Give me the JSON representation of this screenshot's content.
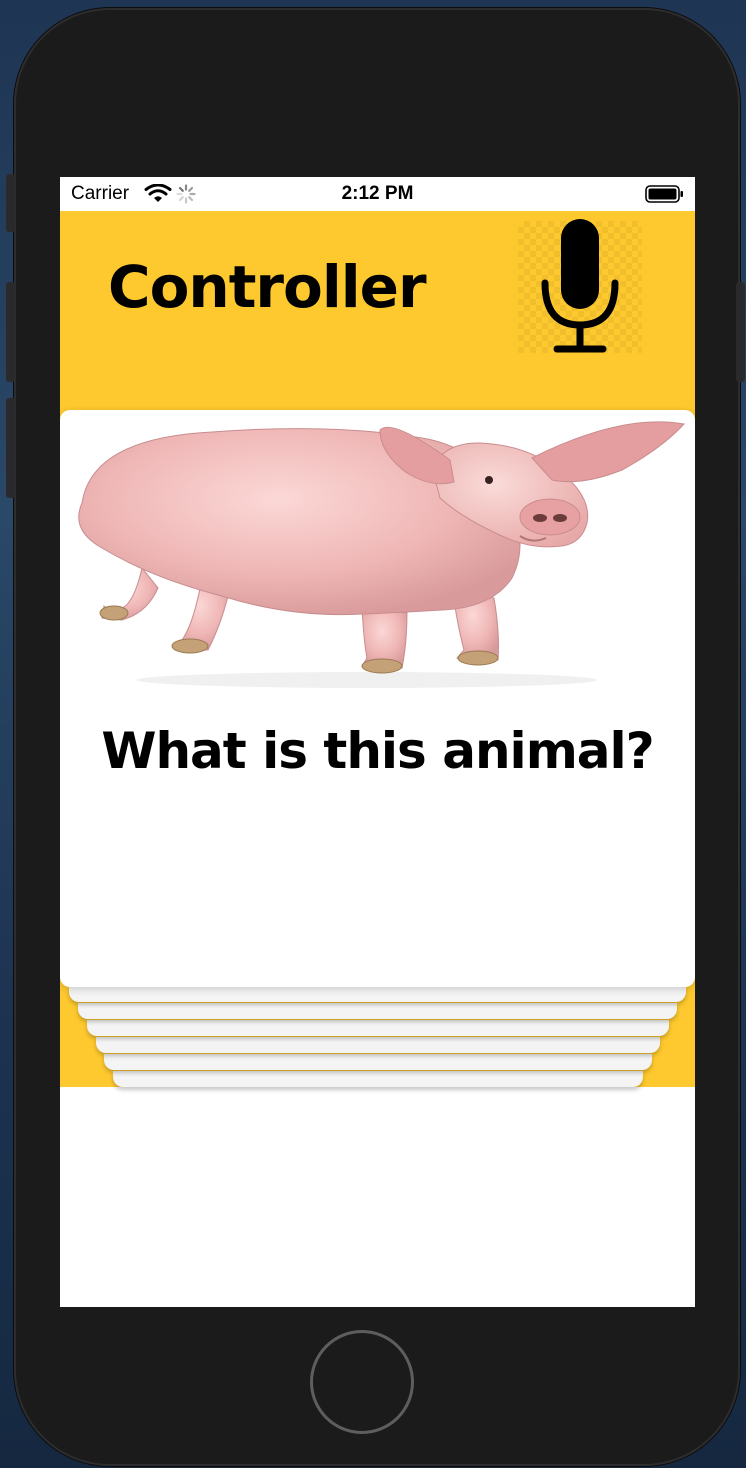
{
  "status_bar": {
    "carrier": "Carrier",
    "time": "2:12 PM"
  },
  "header": {
    "title": "Controller",
    "mic_icon": "microphone-icon",
    "background_color": "#fec92e"
  },
  "card": {
    "image": "pig",
    "question": "What is this animal?"
  },
  "device": {
    "home_button_icon": "home-button"
  }
}
